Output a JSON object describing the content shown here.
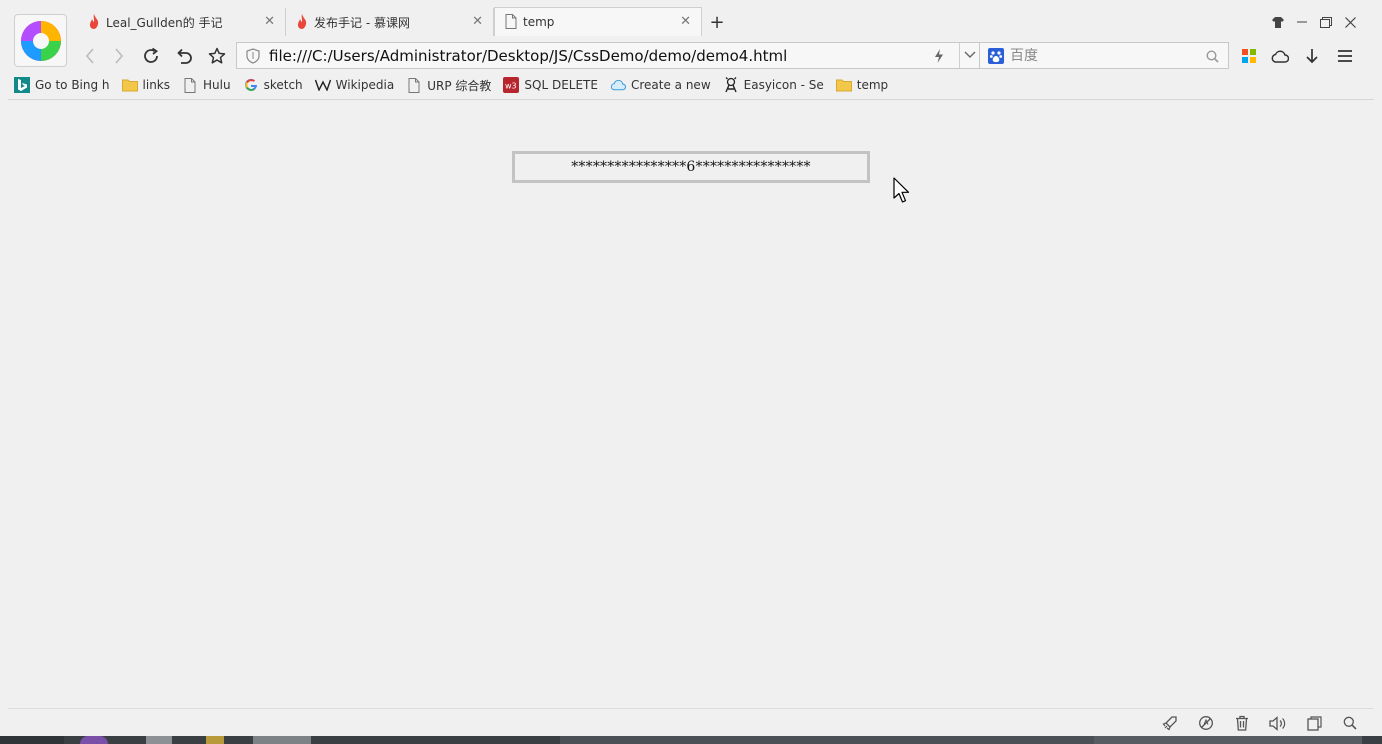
{
  "window": {
    "tabs": [
      {
        "label": "Leal_Gullden的 手记",
        "icon": "flame-icon"
      },
      {
        "label": "发布手记 - 慕课网",
        "icon": "flame-icon"
      },
      {
        "label": "temp",
        "icon": "page-icon",
        "active": true
      }
    ],
    "new_tab_label": "+"
  },
  "navbar": {
    "url": "file:///C:/Users/Administrator/Desktop/JS/CssDemo/demo/demo4.html",
    "search_placeholder": "百度"
  },
  "bookmarks": [
    {
      "label": "Go to Bing h",
      "icon": "bing-icon"
    },
    {
      "label": "links",
      "icon": "folder-icon"
    },
    {
      "label": "Hulu",
      "icon": "page-icon"
    },
    {
      "label": "sketch",
      "icon": "google-icon"
    },
    {
      "label": "Wikipedia",
      "icon": "wikipedia-icon"
    },
    {
      "label": "URP 综合教",
      "icon": "page-icon"
    },
    {
      "label": "SQL DELETE",
      "icon": "w3schools-icon"
    },
    {
      "label": "Create a new",
      "icon": "cloud-icon"
    },
    {
      "label": "Easyicon - Se",
      "icon": "easyicon-icon"
    },
    {
      "label": "temp",
      "icon": "folder-icon"
    }
  ],
  "content": {
    "demo_text": "****************6****************"
  },
  "colors": {
    "background": "#f0f0f0",
    "flame": "#e8473a",
    "bing": "#138a8a",
    "w3": "#b7262f",
    "folder": "#f3c84a",
    "baidu": "#2b5fd9"
  }
}
